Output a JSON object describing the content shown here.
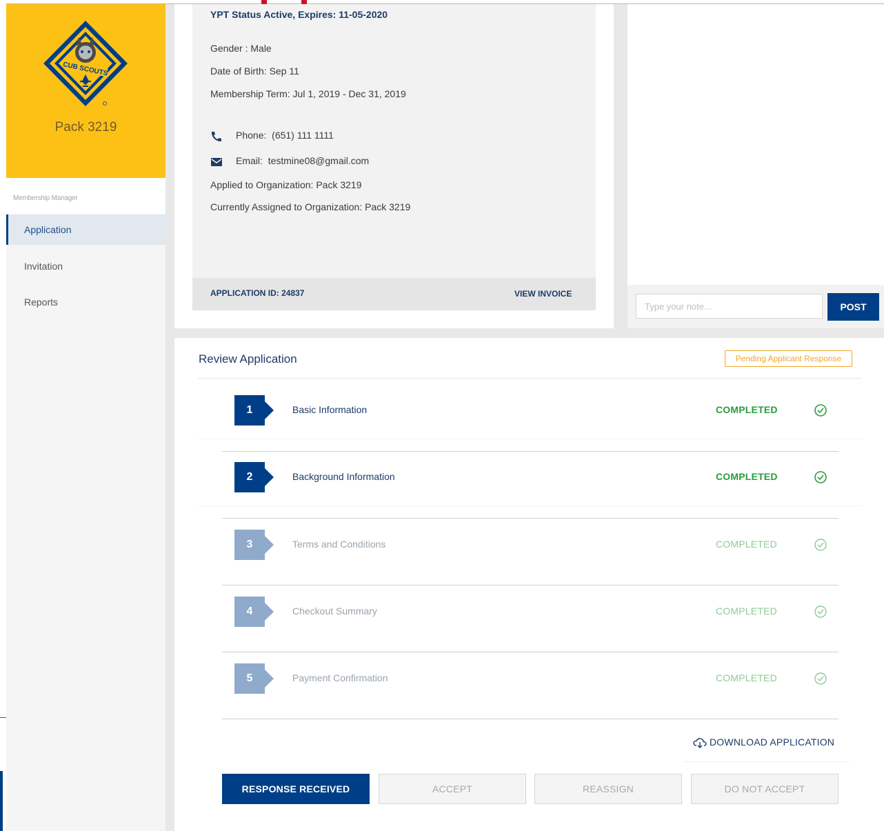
{
  "sidebar": {
    "pack_name": "Pack 3219",
    "logo_text": "CUB SCOUTS",
    "section_caption": "Membership Manager",
    "items": [
      {
        "label": "Application",
        "active": true
      },
      {
        "label": "Invitation",
        "active": false
      },
      {
        "label": "Reports",
        "active": false
      }
    ]
  },
  "profile": {
    "ypt_status": "YPT Status Active, Expires: 11-05-2020",
    "gender": "Gender : Male",
    "dob": "Date of Birth: Sep 11",
    "term": "Membership Term: Jul 1, 2019 - Dec 31, 2019",
    "phone_label": "Phone:",
    "phone": "(651) 111 1111",
    "email_label": "Email:",
    "email": "testmine08@gmail.com",
    "applied_org": "Applied to Organization: Pack 3219",
    "assigned_org": "Currently Assigned to Organization: Pack 3219",
    "application_id": "APPLICATION ID: 24837",
    "view_invoice": "VIEW INVOICE"
  },
  "notes": {
    "placeholder": "Type your note...",
    "value": "",
    "post_label": "POST"
  },
  "review": {
    "title": "Review Application",
    "badge": "Pending Applicant Response",
    "steps": [
      {
        "num": "1",
        "label": "Basic Information",
        "status": "COMPLETED",
        "enabled": true
      },
      {
        "num": "2",
        "label": "Background Information",
        "status": "COMPLETED",
        "enabled": true
      },
      {
        "num": "3",
        "label": "Terms and Conditions",
        "status": "COMPLETED",
        "enabled": false
      },
      {
        "num": "4",
        "label": "Checkout Summary",
        "status": "COMPLETED",
        "enabled": false
      },
      {
        "num": "5",
        "label": "Payment Confirmation",
        "status": "COMPLETED",
        "enabled": false
      }
    ],
    "download_label": "DOWNLOAD APPLICATION",
    "actions": {
      "response_received": "RESPONSE RECEIVED",
      "accept": "ACCEPT",
      "reassign": "REASSIGN",
      "do_not_accept": "DO NOT ACCEPT"
    }
  },
  "colors": {
    "brand_yellow": "#fdc116",
    "primary_blue": "#003f87",
    "success_green": "#2a9d3c",
    "pending_orange": "#f5a623"
  }
}
